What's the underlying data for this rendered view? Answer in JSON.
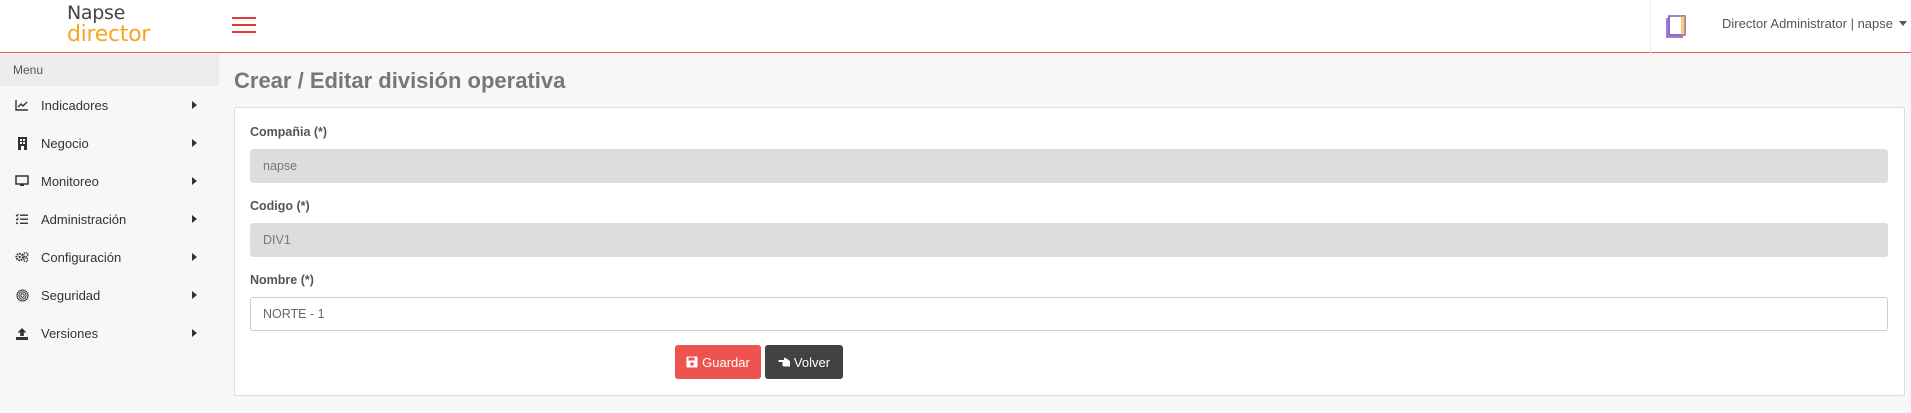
{
  "app": {
    "logo_top": "Napse",
    "logo_bottom": "director",
    "user_label": "Director Administrator | napse"
  },
  "colors": {
    "accent": "#ef5350",
    "logo_orange": "#f5a623",
    "dark_button": "#424242"
  },
  "sidebar": {
    "header": "Menu",
    "items": [
      {
        "label": "Indicadores",
        "icon": "line-chart-icon"
      },
      {
        "label": "Negocio",
        "icon": "building-icon"
      },
      {
        "label": "Monitoreo",
        "icon": "monitor-icon"
      },
      {
        "label": "Administración",
        "icon": "list-check-icon"
      },
      {
        "label": "Configuración",
        "icon": "gears-icon"
      },
      {
        "label": "Seguridad",
        "icon": "fingerprint-icon"
      },
      {
        "label": "Versiones",
        "icon": "upload-icon"
      }
    ]
  },
  "main": {
    "title": "Crear / Editar división operativa",
    "form": {
      "company_label": "Compañia (*)",
      "company_value": "napse",
      "code_label": "Codigo (*)",
      "code_value": "DIV1",
      "name_label": "Nombre (*)",
      "name_value": "NORTE - 1"
    },
    "buttons": {
      "save_label": "Guardar",
      "back_label": "Volver"
    }
  }
}
